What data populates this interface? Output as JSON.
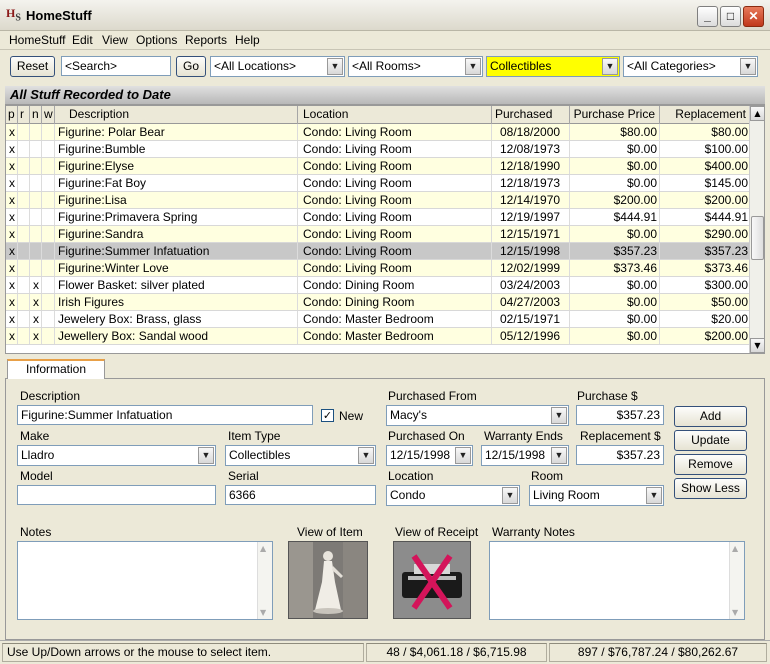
{
  "app": {
    "title": "HomeStuff",
    "icon_letters": "H",
    "icon_sub": "S"
  },
  "window_buttons": {
    "minimize": "_",
    "maximize": "□",
    "close": "✕"
  },
  "menu": [
    "HomeStuff",
    "Edit",
    "View",
    "Options",
    "Reports",
    "Help"
  ],
  "toolbar": {
    "reset_label": "Reset",
    "search_value": "<Search>",
    "go_label": "Go",
    "locations": "<All Locations>",
    "rooms": "<All Rooms>",
    "collection": "Collectibles",
    "categories": "<All Categories>"
  },
  "list_header": "All Stuff Recorded to Date",
  "table": {
    "columns": [
      "p",
      "r",
      "n",
      "w",
      "Description",
      "Location",
      "Purchased",
      "Purchase Price",
      "Replacement"
    ],
    "rows": [
      {
        "p": "x",
        "r": "",
        "n": "",
        "w": "",
        "desc": "Figurine: Polar Bear",
        "loc": "Condo: Living Room",
        "date": "08/18/2000",
        "price": "$80.00",
        "repl": "$80.00"
      },
      {
        "p": "x",
        "r": "",
        "n": "",
        "w": "",
        "desc": "Figurine:Bumble",
        "loc": "Condo: Living Room",
        "date": "12/08/1973",
        "price": "$0.00",
        "repl": "$100.00"
      },
      {
        "p": "x",
        "r": "",
        "n": "",
        "w": "",
        "desc": "Figurine:Elyse",
        "loc": "Condo: Living Room",
        "date": "12/18/1990",
        "price": "$0.00",
        "repl": "$400.00"
      },
      {
        "p": "x",
        "r": "",
        "n": "",
        "w": "",
        "desc": "Figurine:Fat Boy",
        "loc": "Condo: Living Room",
        "date": "12/18/1973",
        "price": "$0.00",
        "repl": "$145.00"
      },
      {
        "p": "x",
        "r": "",
        "n": "",
        "w": "",
        "desc": "Figurine:Lisa",
        "loc": "Condo: Living Room",
        "date": "12/14/1970",
        "price": "$200.00",
        "repl": "$200.00"
      },
      {
        "p": "x",
        "r": "",
        "n": "",
        "w": "",
        "desc": "Figurine:Primavera Spring",
        "loc": "Condo: Living Room",
        "date": "12/19/1997",
        "price": "$444.91",
        "repl": "$444.91"
      },
      {
        "p": "x",
        "r": "",
        "n": "",
        "w": "",
        "desc": "Figurine:Sandra",
        "loc": "Condo: Living Room",
        "date": "12/15/1971",
        "price": "$0.00",
        "repl": "$290.00"
      },
      {
        "p": "x",
        "r": "",
        "n": "",
        "w": "",
        "desc": "Figurine:Summer Infatuation",
        "loc": "Condo: Living Room",
        "date": "12/15/1998",
        "price": "$357.23",
        "repl": "$357.23"
      },
      {
        "p": "x",
        "r": "",
        "n": "",
        "w": "",
        "desc": "Figurine:Winter Love",
        "loc": "Condo: Living Room",
        "date": "12/02/1999",
        "price": "$373.46",
        "repl": "$373.46"
      },
      {
        "p": "x",
        "r": "",
        "n": "x",
        "w": "",
        "desc": "Flower Basket: silver plated",
        "loc": "Condo: Dining Room",
        "date": "03/24/2003",
        "price": "$0.00",
        "repl": "$300.00"
      },
      {
        "p": "x",
        "r": "",
        "n": "x",
        "w": "",
        "desc": "Irish Figures",
        "loc": "Condo: Dining Room",
        "date": "04/27/2003",
        "price": "$0.00",
        "repl": "$50.00"
      },
      {
        "p": "x",
        "r": "",
        "n": "x",
        "w": "",
        "desc": "Jewelery Box: Brass, glass",
        "loc": "Condo: Master Bedroom",
        "date": "02/15/1971",
        "price": "$0.00",
        "repl": "$20.00"
      },
      {
        "p": "x",
        "r": "",
        "n": "x",
        "w": "",
        "desc": "Jewellery Box: Sandal wood",
        "loc": "Condo: Master Bedroom",
        "date": "05/12/1996",
        "price": "$0.00",
        "repl": "$200.00"
      }
    ]
  },
  "tab_label": "Information",
  "form": {
    "description_label": "Description",
    "description_value": "Figurine:Summer Infatuation",
    "new_label": "New",
    "new_checked": "✓",
    "purchased_from_label": "Purchased From",
    "purchased_from_value": "Macy's",
    "purchase_amount_label": "Purchase $",
    "purchase_amount_value": "$357.23",
    "make_label": "Make",
    "make_value": "Lladro",
    "item_type_label": "Item Type",
    "item_type_value": "Collectibles",
    "purchased_on_label": "Purchased On",
    "purchased_on_value": "12/15/1998",
    "warranty_ends_label": "Warranty Ends",
    "warranty_ends_value": "12/15/1998",
    "replacement_label": "Replacement $",
    "replacement_value": "$357.23",
    "model_label": "Model",
    "model_value": "",
    "serial_label": "Serial",
    "serial_value": "6366",
    "location_label": "Location",
    "location_value": "Condo",
    "room_label": "Room",
    "room_value": "Living Room",
    "notes_label": "Notes",
    "view_item_label": "View of Item",
    "view_receipt_label": "View of Receipt",
    "warranty_notes_label": "Warranty Notes",
    "add_label": "Add",
    "update_label": "Update",
    "remove_label": "Remove",
    "show_less_label": "Show Less"
  },
  "status": {
    "hint": "Use Up/Down arrows or the mouse to select item.",
    "filtered_totals": "48 / $4,061.18 / $6,715.98",
    "all_totals": "897 / $76,787.24 / $80,262.67"
  },
  "colors": {
    "highlight_yellow": "#ffff00",
    "row_alt": "#ffffe0",
    "row_selected": "#c8c8c8"
  }
}
